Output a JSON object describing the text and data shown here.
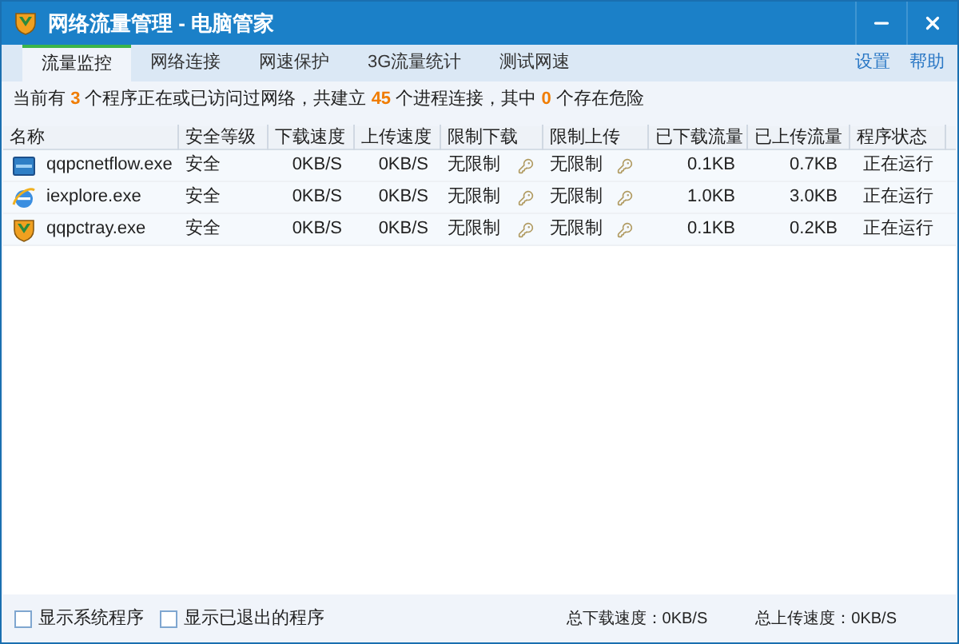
{
  "window": {
    "title": "网络流量管理 - 电脑管家",
    "buttons": [
      {
        "kind": "minimize"
      },
      {
        "kind": "close"
      }
    ]
  },
  "tabs": [
    {
      "label": "流量监控",
      "selected": true
    },
    {
      "label": "网络连接",
      "selected": false
    },
    {
      "label": "网速保护",
      "selected": false
    },
    {
      "label": "3G流量统计",
      "selected": false
    },
    {
      "label": "测试网速",
      "selected": false
    }
  ],
  "links": [
    "设置",
    "帮助"
  ],
  "summary": [
    {
      "text": "当前有 ",
      "highlight": false
    },
    {
      "text": "3",
      "highlight": true
    },
    {
      "text": " 个程序正在或已访问过网络，共建立 ",
      "highlight": false
    },
    {
      "text": "45",
      "highlight": true
    },
    {
      "text": " 个进程连接，其中 ",
      "highlight": false
    },
    {
      "text": "0",
      "highlight": true
    },
    {
      "text": " 个存在危险",
      "highlight": false
    }
  ],
  "table": {
    "columns": [
      "名称",
      "安全等级",
      "下载速度",
      "上传速度",
      "限制下载",
      "限制上传",
      "已下载流量",
      "已上传流量",
      "程序状态"
    ],
    "rows": [
      {
        "kind": "monitor",
        "name": "qqpcnetflow.exe",
        "security": "安全",
        "down_speed": "0KB/S",
        "up_speed": "0KB/S",
        "limit_down": "无限制",
        "limit_up": "无限制",
        "downloaded": "0.1KB",
        "uploaded": "0.7KB",
        "status": "正在运行"
      },
      {
        "kind": "browser",
        "name": "iexplore.exe",
        "security": "安全",
        "down_speed": "0KB/S",
        "up_speed": "0KB/S",
        "limit_down": "无限制",
        "limit_up": "无限制",
        "downloaded": "1.0KB",
        "uploaded": "3.0KB",
        "status": "正在运行"
      },
      {
        "kind": "shield",
        "name": "qqpctray.exe",
        "security": "安全",
        "down_speed": "0KB/S",
        "up_speed": "0KB/S",
        "limit_down": "无限制",
        "limit_up": "无限制",
        "downloaded": "0.1KB",
        "uploaded": "0.2KB",
        "status": "正在运行"
      }
    ]
  },
  "footer": {
    "options": [
      {
        "label": "显示系统程序",
        "checked": false
      },
      {
        "label": "显示已退出的程序",
        "checked": false
      }
    ],
    "total_down": "总下载速度：0KB/S",
    "total_up": "总上传速度：0KB/S"
  }
}
